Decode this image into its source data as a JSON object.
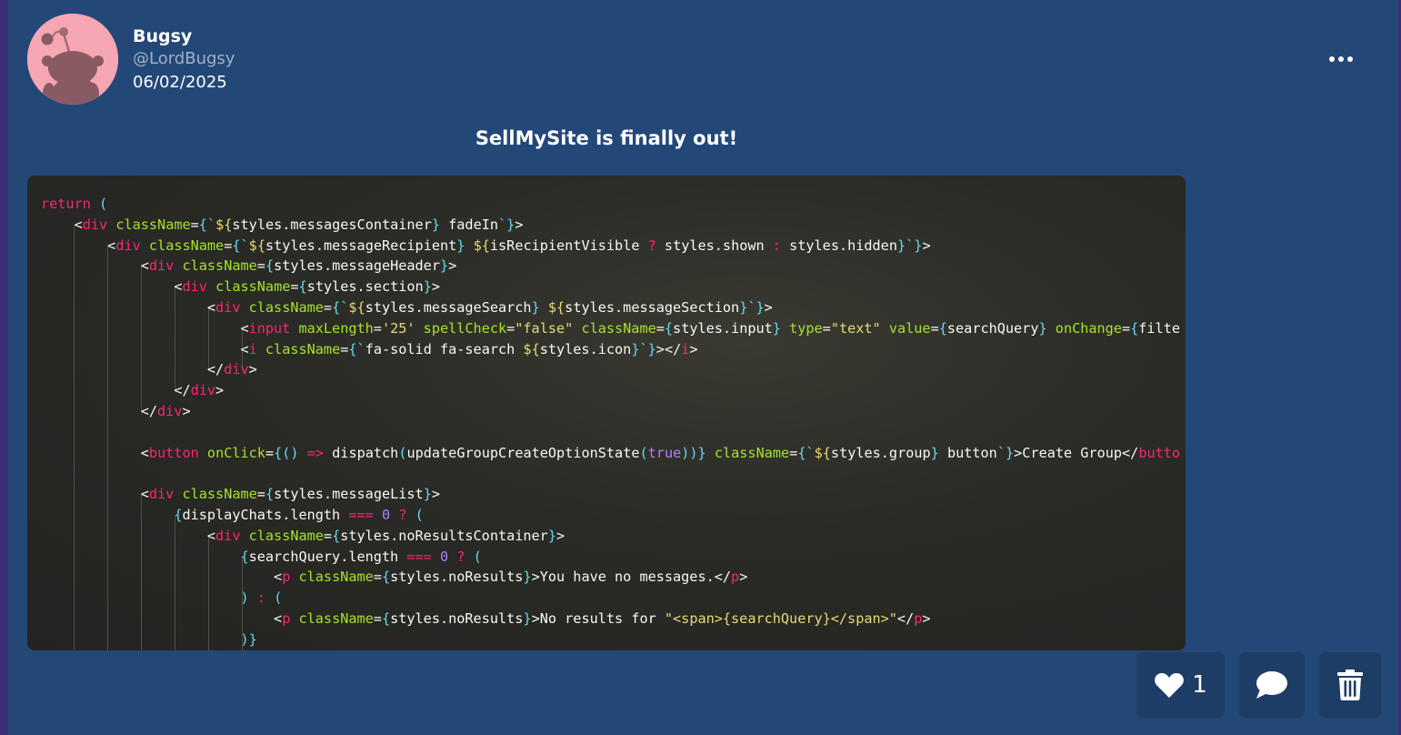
{
  "post": {
    "author_name": "Bugsy",
    "author_handle": "@LordBugsy",
    "date": "06/02/2025",
    "title": "SellMySite is finally out!"
  },
  "code_lines": [
    "return (",
    "    <div className={`${styles.messagesContainer} fadeIn`}>",
    "        <div className={`${styles.messageRecipient} ${isRecipientVisible ? styles.shown : styles.hidden}`}>",
    "            <div className={styles.messageHeader}>",
    "                <div className={styles.section}>",
    "                    <div className={`${styles.messageSearch} ${styles.messageSection}`}>",
    "                        <input maxLength='25' spellCheck=\"false\" className={styles.input} type=\"text\" value={searchQuery} onChange={filte",
    "                        <i className={`fa-solid fa-search ${styles.icon}`}></i>",
    "                    </div>",
    "                </div>",
    "            </div>",
    "",
    "            <button onClick={() => dispatch(updateGroupCreateOptionState(true))} className={`${styles.group} button`}>Create Group</butto",
    "",
    "            <div className={styles.messageList}>",
    "                {displayChats.length === 0 ? (",
    "                    <div className={styles.noResultsContainer}>",
    "                        {searchQuery.length === 0 ? (",
    "                            <p className={styles.noResults}>You have no messages.</p>",
    "                        ) : (",
    "                            <p className={styles.noResults}>No results for \"<span>{searchQuery}</span>\"</p>",
    "                        )}"
  ],
  "actions": {
    "like_count": "1"
  },
  "icons": {
    "avatar": "reddit-alien-avatar",
    "more": "ellipsis-icon",
    "like": "heart-icon",
    "comment": "comment-icon",
    "delete": "trash-icon"
  },
  "colors": {
    "background": "#234878",
    "card": "#1e3d66",
    "avatar_bg": "#f6a7b3"
  }
}
